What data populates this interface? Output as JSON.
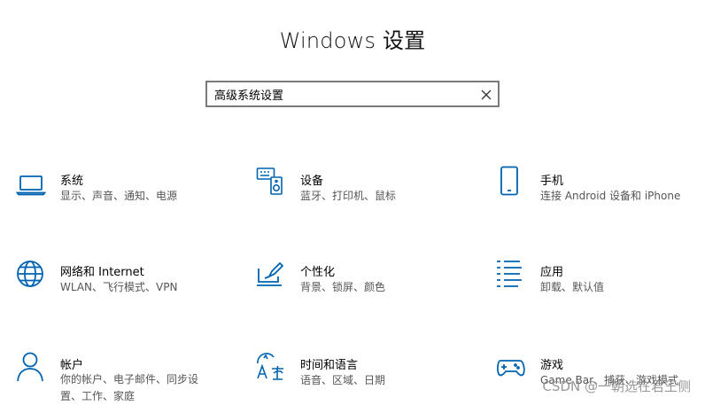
{
  "window": {
    "title": "Windows 设置"
  },
  "search": {
    "value": "高级系统设置"
  },
  "accent": "#0063b1",
  "tiles": [
    {
      "icon": "laptop-icon",
      "title": "系统",
      "desc": "显示、声音、通知、电源"
    },
    {
      "icon": "devices-icon",
      "title": "设备",
      "desc": "蓝牙、打印机、鼠标"
    },
    {
      "icon": "phone-icon",
      "title": "手机",
      "desc": "连接 Android 设备和 iPhone"
    },
    {
      "icon": "globe-icon",
      "title": "网络和 Internet",
      "desc": "WLAN、飞行模式、VPN"
    },
    {
      "icon": "personalization-icon",
      "title": "个性化",
      "desc": "背景、锁屏、颜色"
    },
    {
      "icon": "apps-list-icon",
      "title": "应用",
      "desc": "卸载、默认值"
    },
    {
      "icon": "person-icon",
      "title": "帐户",
      "desc": "你的帐户、电子邮件、同步设置、工作、家庭"
    },
    {
      "icon": "language-icon",
      "title": "时间和语言",
      "desc": "语音、区域、日期"
    },
    {
      "icon": "gamepad-icon",
      "title": "游戏",
      "desc": "Game Bar、捕获、游戏模式"
    }
  ],
  "watermark": "CSDN @一朝选在君王侧"
}
